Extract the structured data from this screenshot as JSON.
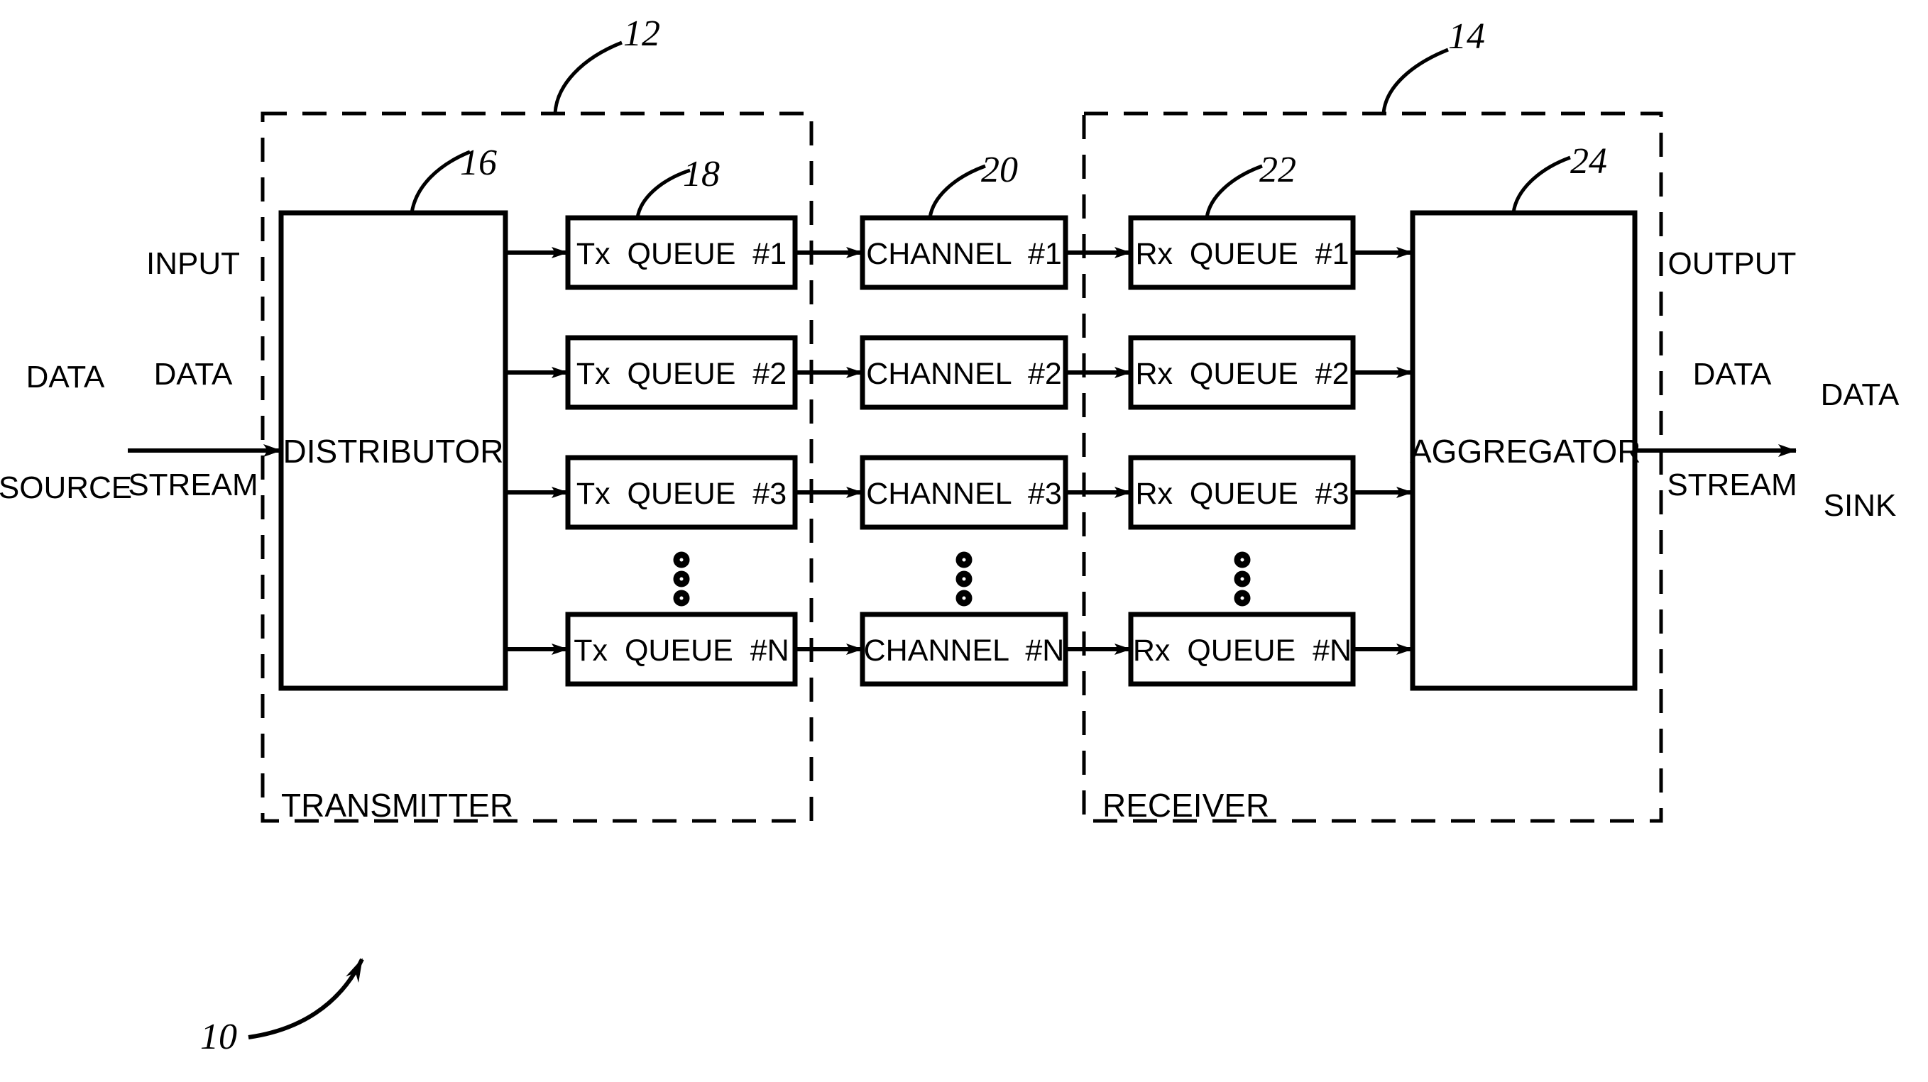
{
  "figure": {
    "kind": "patent-block-diagram",
    "figure_ref": "10",
    "stroke_color": "#000000",
    "background_color": "#ffffff"
  },
  "reference_numerals": {
    "system": "10",
    "transmitter": "12",
    "receiver": "14",
    "distributor": "16",
    "tx_queue": "18",
    "channel": "20",
    "rx_queue": "22",
    "aggregator": "24"
  },
  "endpoints": {
    "source_line1": "DATA",
    "source_line2": "SOURCE",
    "sink_line1": "DATA",
    "sink_line2": "SINK"
  },
  "streams": {
    "input_line1": "INPUT",
    "input_line2": "DATA",
    "input_line3": "STREAM",
    "output_line1": "OUTPUT",
    "output_line2": "DATA",
    "output_line3": "STREAM"
  },
  "zones": {
    "transmitter_label": "TRANSMITTER",
    "receiver_label": "RECEIVER"
  },
  "blocks": {
    "distributor": "DISTRIBUTOR",
    "aggregator": "AGGREGATOR"
  },
  "rows": [
    {
      "tx_queue": "Tx  QUEUE  #1",
      "channel": "CHANNEL  #1",
      "rx_queue": "Rx  QUEUE  #1"
    },
    {
      "tx_queue": "Tx  QUEUE  #2",
      "channel": "CHANNEL  #2",
      "rx_queue": "Rx  QUEUE  #2"
    },
    {
      "tx_queue": "Tx  QUEUE  #3",
      "channel": "CHANNEL  #3",
      "rx_queue": "Rx  QUEUE  #3"
    },
    {
      "tx_queue": "Tx  QUEUE  #N",
      "channel": "CHANNEL  #N",
      "rx_queue": "Rx  QUEUE  #N"
    }
  ],
  "ellipsis": {
    "glyph": "vertical-ellipsis",
    "dot_count": 3
  }
}
